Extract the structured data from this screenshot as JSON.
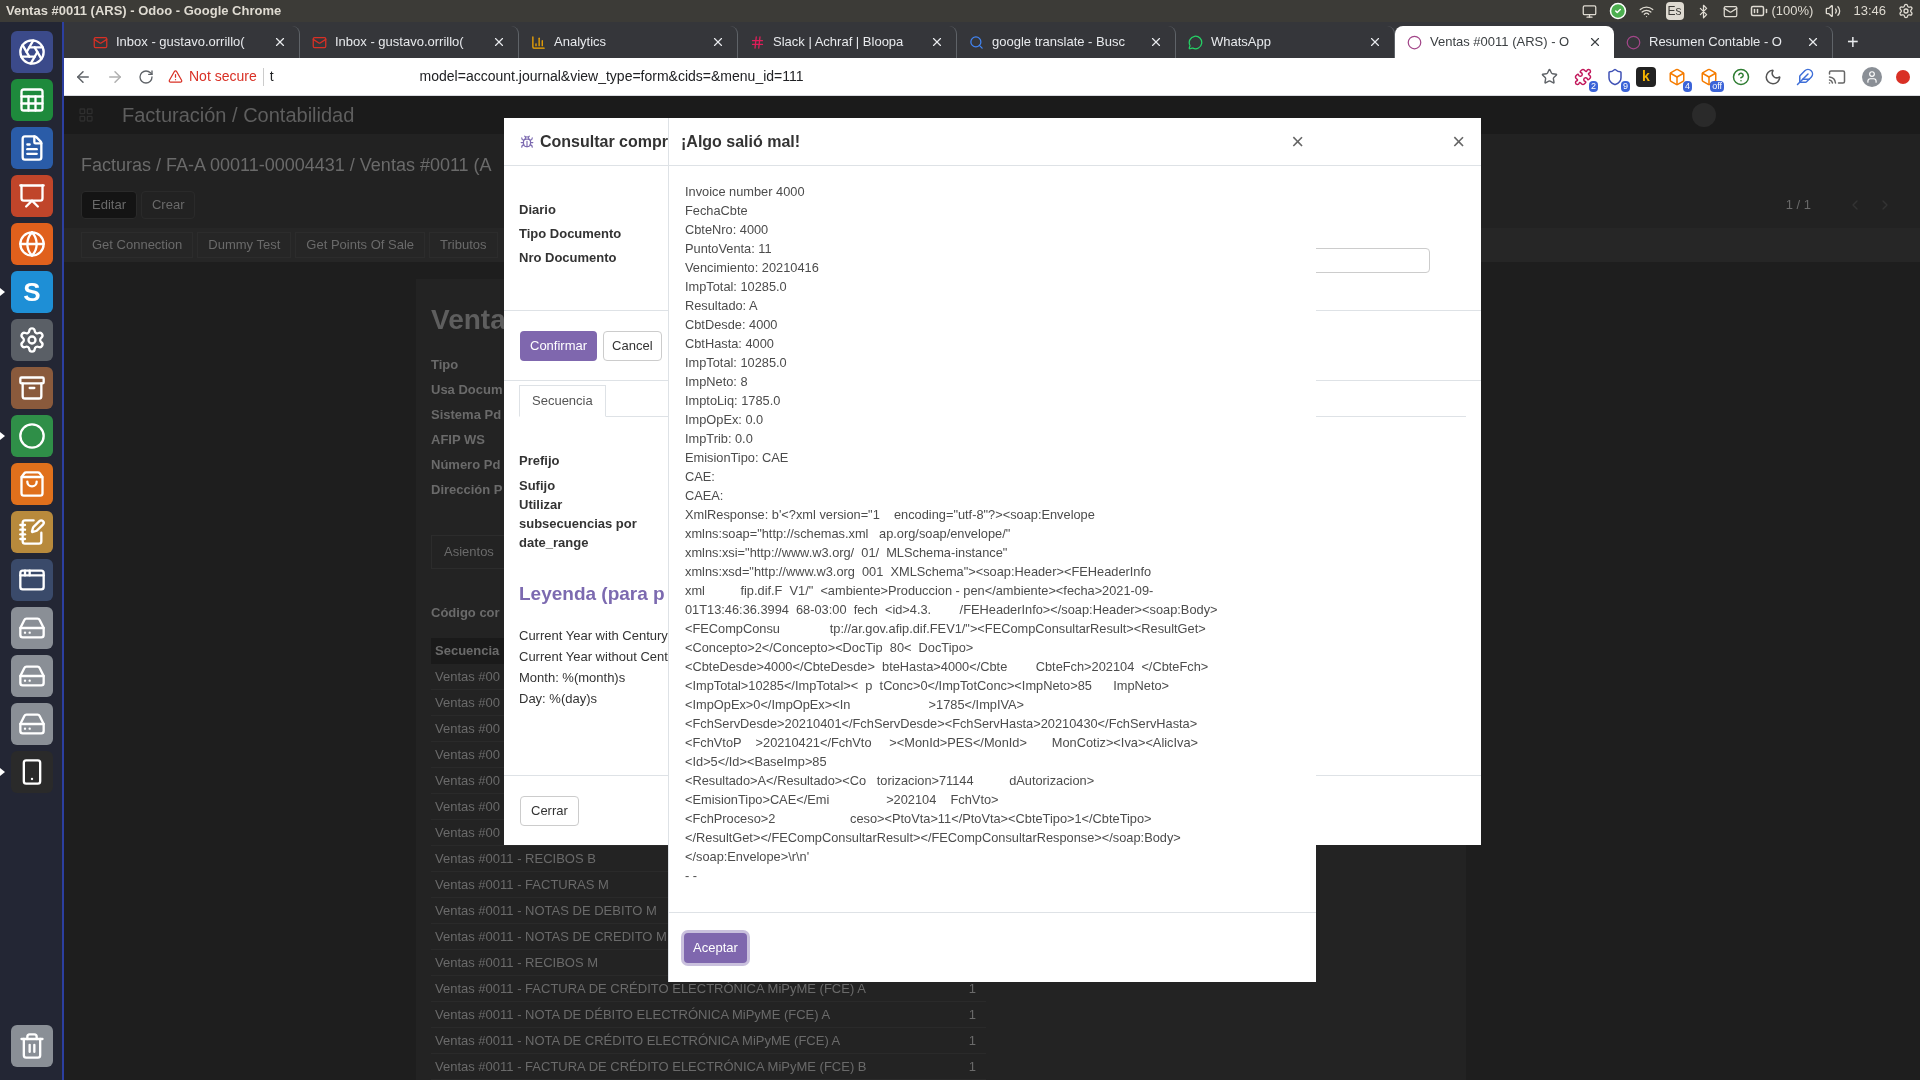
{
  "system_bar": {
    "window_title": "Ventas #0011 (ARS) - Odoo - Google Chrome",
    "keyboard_layout": "Es",
    "battery": "(100%)",
    "time": "13:46"
  },
  "dock": [
    {
      "kind": "ring",
      "running": false
    },
    {
      "kind": "spreadsheet",
      "running": false
    },
    {
      "kind": "document",
      "running": false
    },
    {
      "kind": "presentation",
      "running": false
    },
    {
      "kind": "globe",
      "running": false
    },
    {
      "kind": "letter",
      "label": "S",
      "running": true
    },
    {
      "kind": "settings",
      "running": false
    },
    {
      "kind": "drawer",
      "running": false
    },
    {
      "kind": "circle",
      "running": true
    },
    {
      "kind": "bag",
      "running": false
    },
    {
      "kind": "notepad",
      "running": false
    },
    {
      "kind": "window",
      "running": false
    },
    {
      "kind": "disk",
      "running": false
    },
    {
      "kind": "disk",
      "running": false
    },
    {
      "kind": "disk",
      "running": false
    },
    {
      "kind": "phone",
      "running": true
    },
    {
      "kind": "trash",
      "running": false
    }
  ],
  "browser": {
    "tabs": [
      {
        "kind": "mail",
        "title": "Inbox - gustavo.orrillo(",
        "selected": false
      },
      {
        "kind": "mail",
        "title": "Inbox - gustavo.orrillo(",
        "selected": false
      },
      {
        "kind": "chart",
        "title": "Analytics",
        "selected": false
      },
      {
        "kind": "hash",
        "title": "Slack | Achraf | Bloopa",
        "selected": false
      },
      {
        "kind": "search",
        "title": "google translate - Busc",
        "selected": false
      },
      {
        "kind": "chat",
        "title": "WhatsApp",
        "selected": false
      },
      {
        "kind": "ring",
        "title": "Ventas #0011 (ARS) - O",
        "selected": true
      },
      {
        "kind": "ring",
        "title": "Resumen Contable - O",
        "selected": false
      }
    ],
    "new_tab": "+",
    "security": "Not secure",
    "url_start": "t",
    "url": "model=account.journal&view_type=form&cids=&menu_id=111",
    "extensions": [
      {
        "kind": "puzzle",
        "badge": "2"
      },
      {
        "kind": "shield",
        "badge": "9"
      },
      {
        "kind": "letter",
        "label": "k"
      },
      {
        "kind": "box",
        "badge": "4"
      },
      {
        "kind": "box",
        "badge": "off"
      },
      {
        "kind": "help"
      },
      {
        "kind": "moon"
      },
      {
        "kind": "feather"
      },
      {
        "kind": "cast"
      }
    ]
  },
  "odoo": {
    "app_title": "Facturación / Contabilidad",
    "breadcrumb": "Facturas / FA-A 00011-00004431 / Ventas #0011 (A",
    "buttons": [
      "Editar",
      "Crear"
    ],
    "pager": "1 / 1",
    "header_buttons": [
      "Get Connection",
      "Dummy Test",
      "Get Points Of Sale",
      "Tributos"
    ],
    "sheet": {
      "title": "Venta",
      "fields": [
        "Tipo",
        "Usa Docum",
        "Sistema Pd",
        "AFIP WS",
        "Número Pd",
        "Dirección P"
      ],
      "tab": "Asientos",
      "section": "Código cor",
      "table": {
        "columns": [
          "Secuencia"
        ],
        "rows": [
          {
            "name": "Ventas #00"
          },
          {
            "name": "Ventas #00"
          },
          {
            "name": "Ventas #00"
          },
          {
            "name": "Ventas #00"
          },
          {
            "name": "Ventas #00"
          },
          {
            "name": "Ventas #00"
          },
          {
            "name": "Ventas #00"
          },
          {
            "name": "Ventas #0011 - RECIBOS B"
          },
          {
            "name": "Ventas #0011 - FACTURAS M"
          },
          {
            "name": "Ventas #0011 - NOTAS DE DEBITO M"
          },
          {
            "name": "Ventas #0011 - NOTAS DE CREDITO M"
          },
          {
            "name": "Ventas #0011 - RECIBOS M"
          },
          {
            "name": "Ventas #0011 - FACTURA DE CRÉDITO ELECTRÓNICA MiPyME (FCE) A",
            "count": "1"
          },
          {
            "name": "Ventas #0011 - NOTA DE DÉBITO ELECTRÓNICA MiPyME (FCE) A",
            "count": "1"
          },
          {
            "name": "Ventas #0011 - NOTA DE CRÉDITO ELECTRÓNICA MiPyME (FCE) A",
            "count": "1"
          },
          {
            "name": "Ventas #0011 - FACTURA DE CRÉDITO ELECTRÓNICA MiPyME (FCE) B",
            "count": "1"
          }
        ]
      }
    }
  },
  "query_dialog": {
    "title": "Consultar compr",
    "close": "×",
    "fields": [
      "Diario",
      "Tipo Documento",
      "Nro Documento"
    ],
    "buttons": [
      "Confirmar",
      "Cancel"
    ],
    "tab": {
      "label": "Secuencia",
      "selected": true
    },
    "sequence_fields": [
      "Prefijo",
      "Sufijo",
      "Utilizar subsecuencias por date_range"
    ],
    "legend_title": "Leyenda (para p",
    "legend": [
      "Current Year with Century",
      "Current Year without Cent",
      "Month: %(month)s",
      "Day: %(day)s"
    ],
    "footer_button": "Cerrar"
  },
  "error_dialog": {
    "title": "¡Algo salió mal!",
    "close": "×",
    "lines": [
      "Invoice number 4000",
      "FechaCbte",
      "CbteNro: 4000",
      "PuntoVenta: 11",
      "Vencimiento: 20210416",
      "ImpTotal: 10285.0",
      "Resultado: A",
      "CbtDesde: 4000",
      "CbtHasta: 4000",
      "ImpTotal: 10285.0",
      "ImpNeto: 8",
      "ImptoLiq: 1785.0",
      "ImpOpEx: 0.0",
      "ImpTrib: 0.0",
      "EmisionTipo: CAE",
      "CAE:",
      "CAEA:",
      "XmlResponse: b'<?xml version=\"1    encoding=\"utf-8\"?><soap:Envelope",
      "xmlns:soap=\"http://schemas.xml   ap.org/soap/envelope/\"",
      "xmlns:xsi=\"http://www.w3.org/  01/  MLSchema-instance\"",
      "xmlns:xsd=\"http://www.w3.org  001  XMLSchema\"><soap:Header><FEHeaderInfo",
      "xml          fip.dif.F  V1/\"  <ambiente>Produccion - pen</ambiente><fecha>2021-09-",
      "01T13:46:36.3994  68-03:00  fech  <id>4.3.        /FEHeaderInfo></soap:Header><soap:Body>",
      "<FECompConsu              tp://ar.gov.afip.dif.FEV1/\"><FECompConsultarResult><ResultGet>",
      "<Concepto>2</Concepto><DocTip  80<  DocTipo>",
      "<CbteDesde>4000</CbteDesde>  bteHasta>4000</Cbte        CbteFch>202104  </CbteFch>",
      "<ImpTotal>10285</ImpTotal><  p  tConc>0</ImpTotConc><ImpNeto>85      ImpNeto>",
      "<ImpOpEx>0</ImpOpEx><In                      >1785</ImpIVA>",
      "<FchServDesde>20210401</FchServDesde><FchServHasta>20210430</FchServHasta>",
      "<FchVtoP    >20210421</FchVto     ><MonId>PES</MonId>       MonCotiz><Iva><AlicIva>",
      "<Id>5</Id><BaseImp>85",
      "<Resultado>A</Resultado><Co   torizacion>71144          dAutorizacion>",
      "<EmisionTipo>CAE</Emi                >202104    FchVto>",
      "<FchProceso>2                     ceso><PtoVta>11</PtoVta><CbteTipo>1</CbteTipo>",
      "</ResultGet></FECompConsultarResult></FECompConsultarResponse></soap:Body>",
      "</soap:Envelope>\\r\\n'",
      "- -"
    ],
    "button": "Aceptar"
  }
}
